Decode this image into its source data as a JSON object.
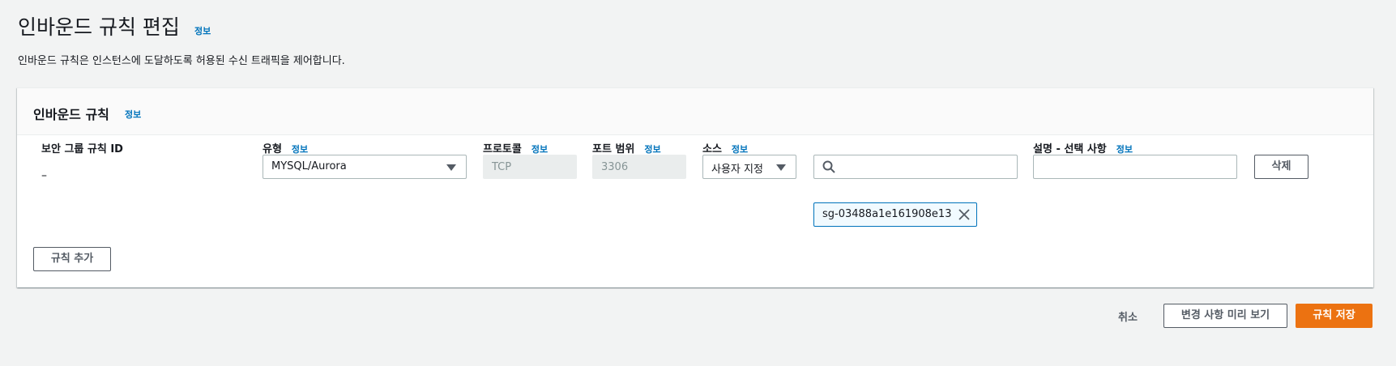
{
  "page": {
    "title": "인바운드 규칙 편집",
    "title_info": "정보",
    "description": "인바운드 규칙은 인스턴스에 도달하도록 허용된 수신 트래픽을 제어합니다."
  },
  "panel": {
    "title": "인바운드 규칙",
    "title_info": "정보",
    "columns": {
      "rule_id": "보안 그룹 규칙 ID",
      "type": "유형",
      "protocol": "프로토콜",
      "port_range": "포트 범위",
      "source": "소스",
      "description": "설명 - 선택 사항"
    },
    "info_label": "정보",
    "rule": {
      "rule_id": "–",
      "type_value": "MYSQL/Aurora",
      "protocol_value": "TCP",
      "port_value": "3306",
      "source_value": "사용자 지정",
      "search_value": "",
      "token_label": "sg-03488a1e161908e13",
      "description_value": "",
      "delete_label": "삭제"
    },
    "add_rule_label": "규칙 추가"
  },
  "footer": {
    "cancel_label": "취소",
    "preview_label": "변경 사항 미리 보기",
    "save_label": "규칙 저장"
  },
  "colors": {
    "link": "#0073bb",
    "primary": "#ec7211",
    "background": "#f2f3f3"
  }
}
